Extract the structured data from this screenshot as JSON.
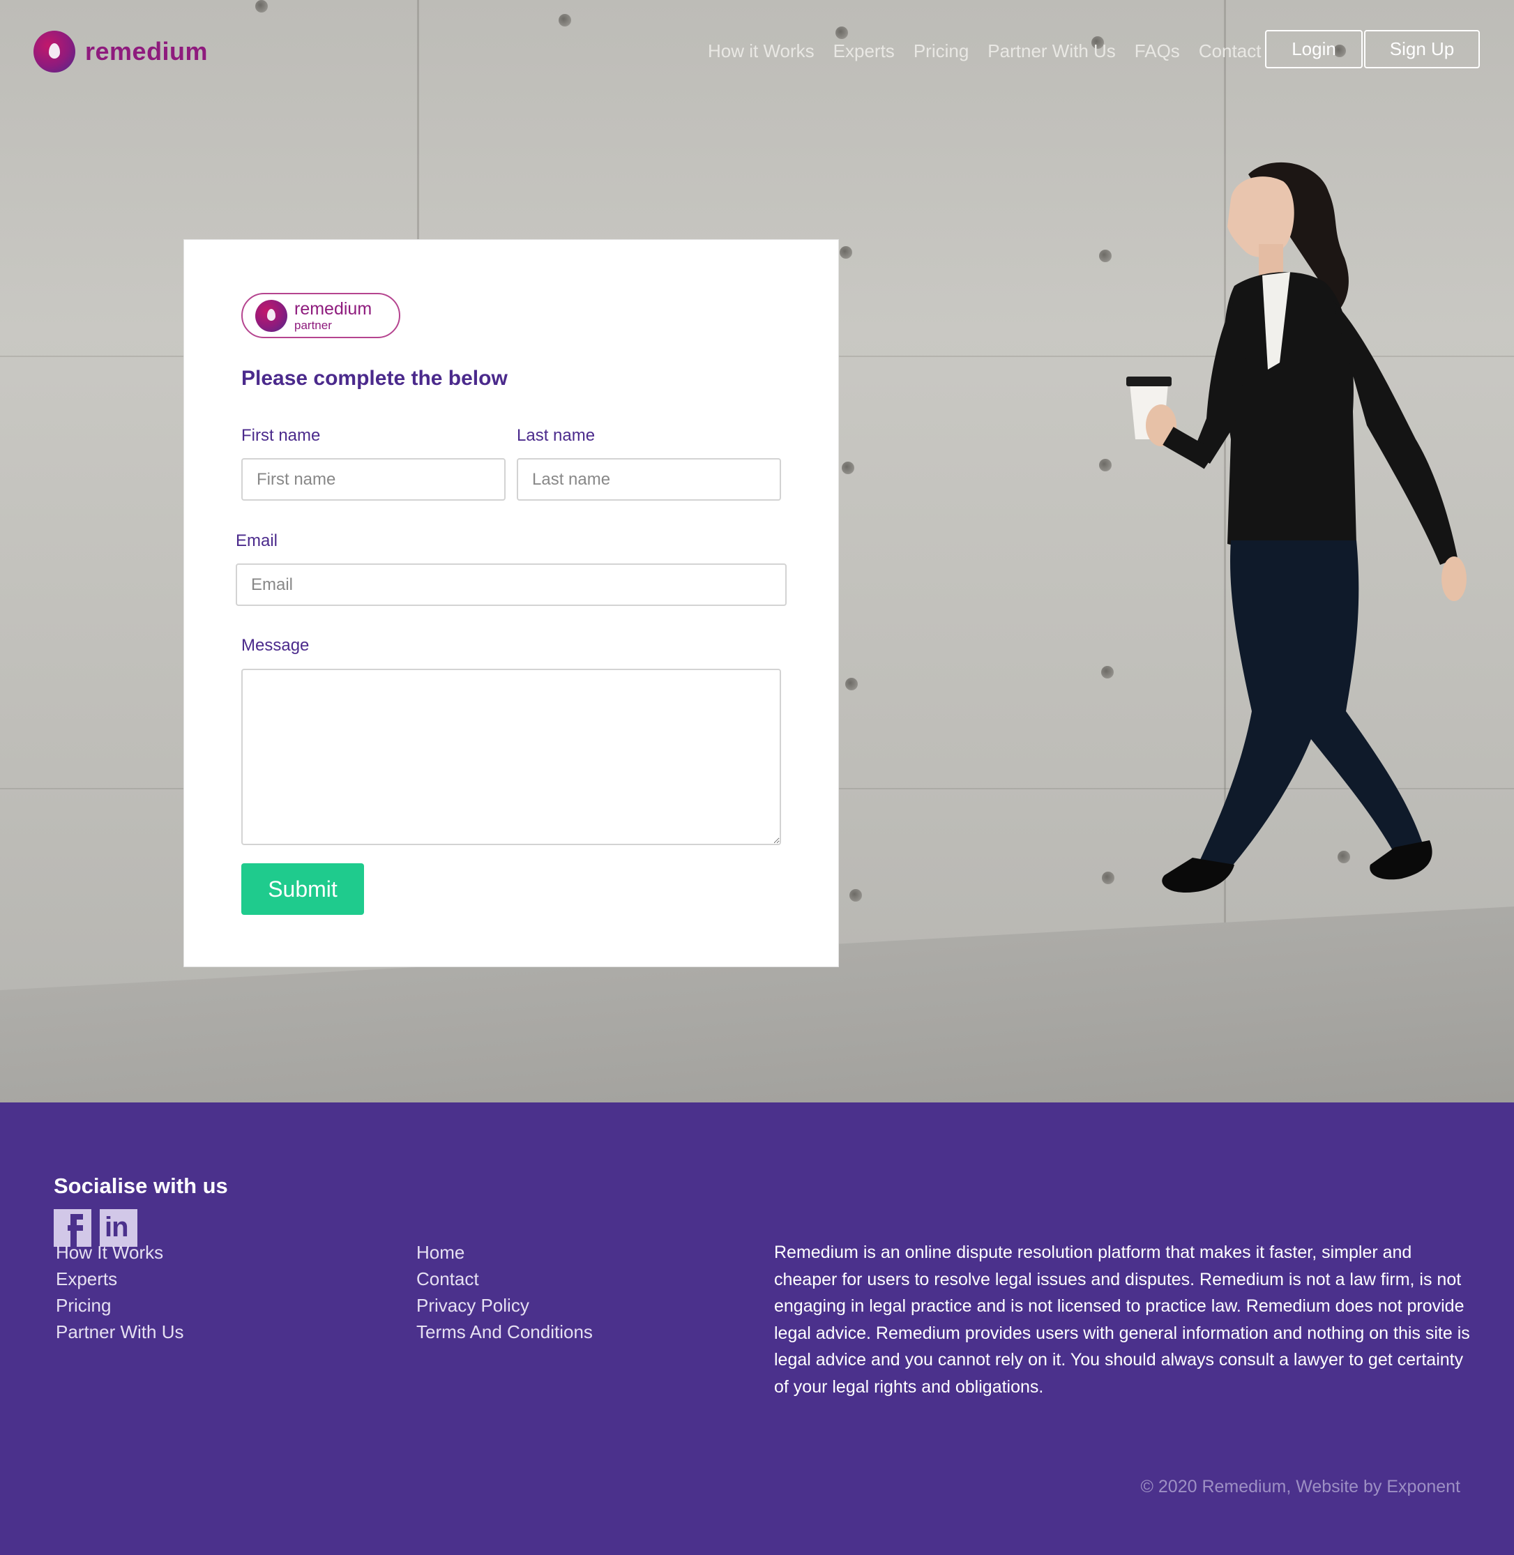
{
  "brand": {
    "name": "remedium",
    "color": "#8e1b7d"
  },
  "nav": {
    "links": [
      "How it Works",
      "Experts",
      "Pricing",
      "Partner With Us",
      "FAQs",
      "Contact"
    ],
    "login_label": "Login",
    "signup_label": "Sign Up"
  },
  "form": {
    "badge_name": "remedium",
    "badge_sub": "partner",
    "title": "Please complete the below",
    "first_name_label": "First name",
    "first_name_placeholder": "First name",
    "last_name_label": "Last name",
    "last_name_placeholder": "Last name",
    "email_label": "Email",
    "email_placeholder": "Email",
    "message_label": "Message",
    "submit_label": "Submit",
    "submit_color": "#1fcb8d",
    "label_color": "#4b2a8c"
  },
  "footer": {
    "background": "#4b318c",
    "social_title": "Socialise with us",
    "social_icons": [
      "facebook-icon",
      "linkedin-icon"
    ],
    "col1": [
      "How It Works",
      "Experts",
      "Pricing",
      "Partner With Us"
    ],
    "col2": [
      "Home",
      "Contact",
      "Privacy Policy",
      "Terms And Conditions"
    ],
    "about": "Remedium is an online dispute resolution platform that makes it faster, simpler and cheaper for users to resolve legal issues and disputes. Remedium is not a law firm, is not engaging in legal practice and is not licensed to practice law. Remedium does not provide legal advice. Remedium provides users with general information and nothing on this site is legal advice and you cannot rely on it. You should always consult a lawyer to get certainty of your legal rights and obligations.",
    "copyright": "© 2020 Remedium, Website by Exponent"
  }
}
